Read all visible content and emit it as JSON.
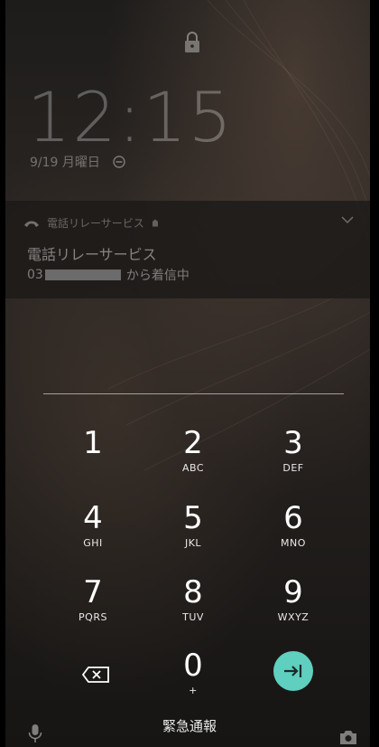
{
  "lockscreen": {
    "time": "12:15",
    "date": "9/19 月曜日",
    "icons": {
      "lock": "lock-icon",
      "dnd": "do-not-disturb-icon"
    }
  },
  "notification": {
    "app_name": "電話リレーサービス",
    "title": "電話リレーサービス",
    "number_prefix": "03",
    "message_suffix": "から着信中",
    "icons": {
      "app": "phone-icon",
      "expand": "chevron-down-icon"
    }
  },
  "keypad": {
    "keys": [
      {
        "digit": "1",
        "letters": ""
      },
      {
        "digit": "2",
        "letters": "ABC"
      },
      {
        "digit": "3",
        "letters": "DEF"
      },
      {
        "digit": "4",
        "letters": "GHI"
      },
      {
        "digit": "5",
        "letters": "JKL"
      },
      {
        "digit": "6",
        "letters": "MNO"
      },
      {
        "digit": "7",
        "letters": "PQRS"
      },
      {
        "digit": "8",
        "letters": "TUV"
      },
      {
        "digit": "9",
        "letters": "WXYZ"
      },
      {
        "digit": "0",
        "letters": "+"
      }
    ],
    "icons": {
      "delete": "backspace-icon",
      "enter": "enter-arrow-icon"
    }
  },
  "footer": {
    "emergency_label": "緊急通報",
    "icons": {
      "left": "mic-icon",
      "right": "camera-icon"
    }
  },
  "colors": {
    "accent": "#5fcfbf"
  }
}
